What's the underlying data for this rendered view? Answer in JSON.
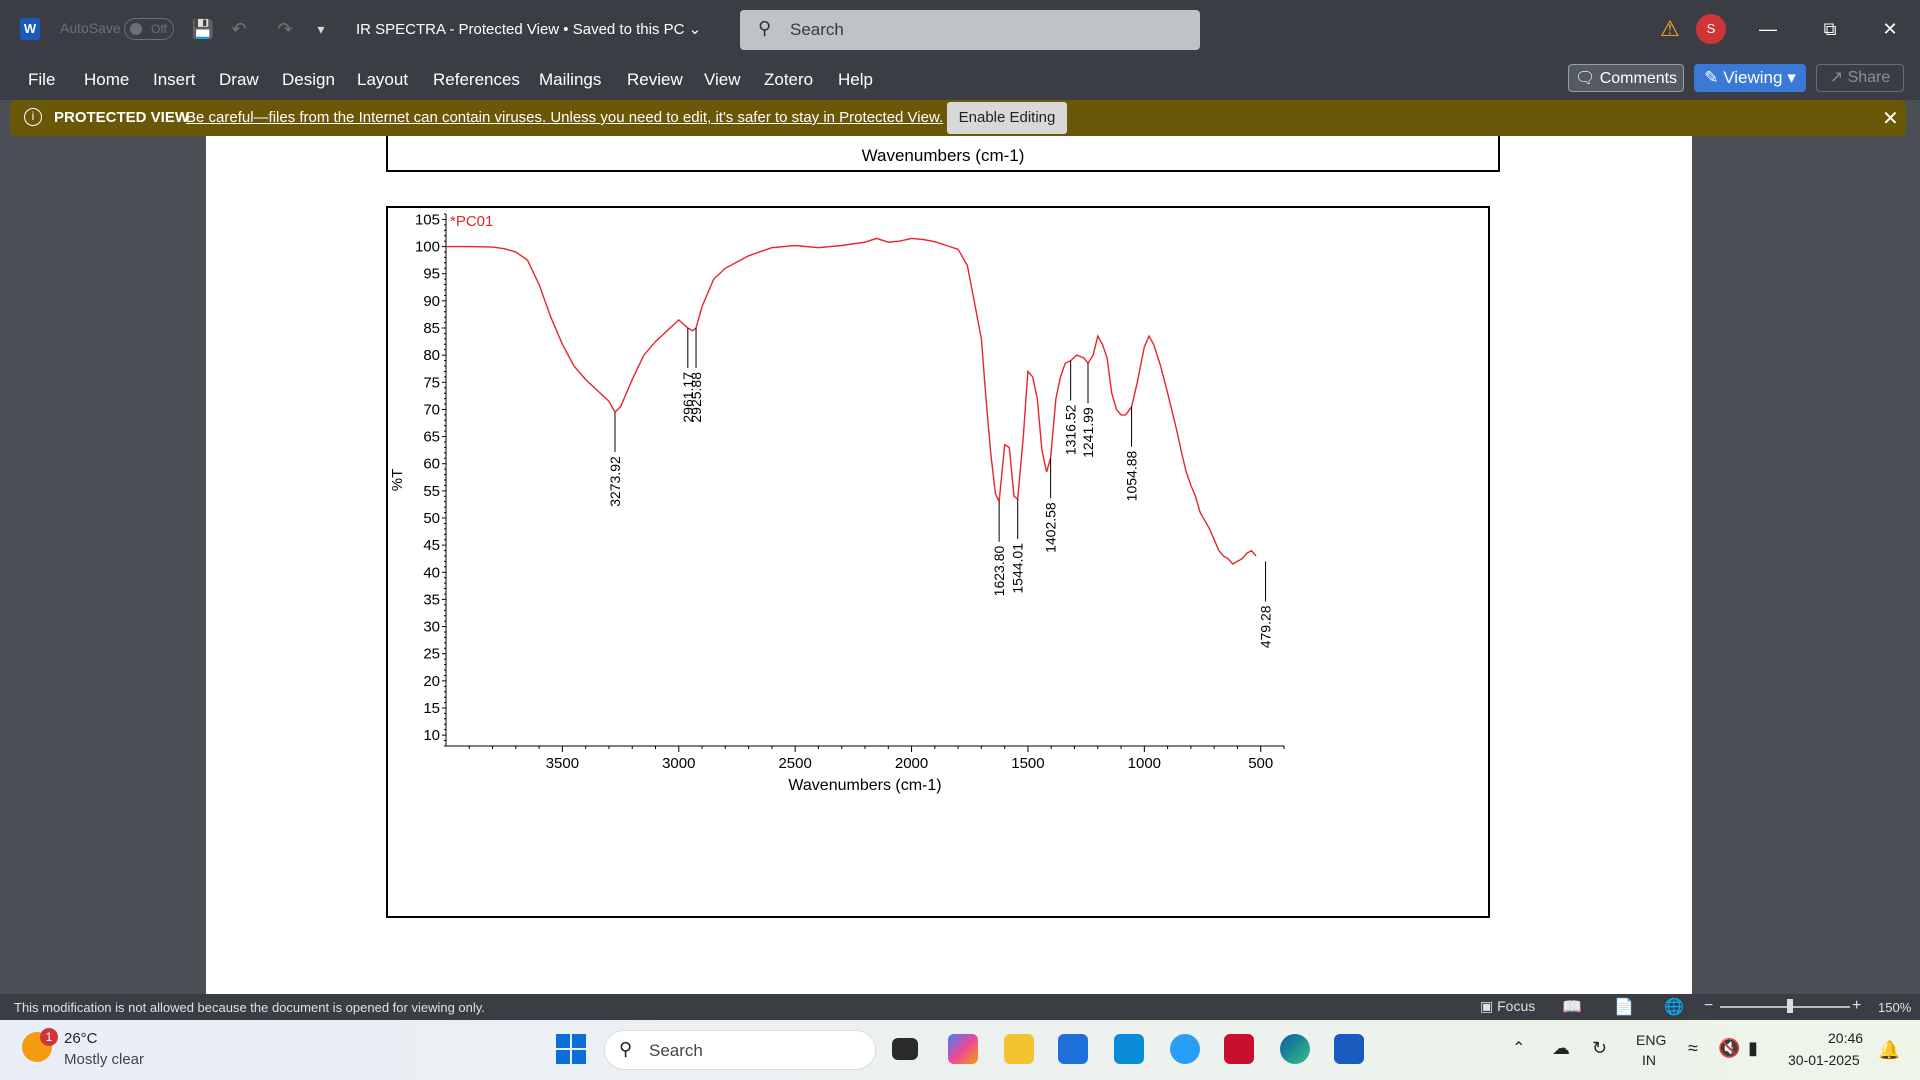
{
  "titlebar": {
    "app_letter": "W",
    "autosave_label": "AutoSave",
    "autosave_state": "Off",
    "doc_title": "IR SPECTRA  -  Protected View • Saved to this PC ⌄",
    "search_placeholder": "Search",
    "avatar_initial": "S"
  },
  "ribbon": {
    "tabs": [
      "File",
      "Home",
      "Insert",
      "Draw",
      "Design",
      "Layout",
      "References",
      "Mailings",
      "Review",
      "View",
      "Zotero",
      "Help"
    ],
    "comments_label": "Comments",
    "viewing_label": "Viewing",
    "share_label": "Share"
  },
  "protected_view": {
    "title": "PROTECTED VIEW",
    "message": "Be careful—files from the Internet can contain viruses. Unless you need to edit, it's safer to stay in Protected View.",
    "enable_label": "Enable Editing"
  },
  "document": {
    "prev_chart_xlabel": "Wavenumbers (cm-1)"
  },
  "chart_data": {
    "type": "line",
    "series": [
      {
        "name": "*PC01",
        "color": "#e8242c"
      }
    ],
    "xlabel": "Wavenumbers (cm-1)",
    "ylabel": "%T",
    "xlim": [
      4000,
      400
    ],
    "ylim": [
      8,
      106
    ],
    "x_ticks": [
      3500,
      3000,
      2500,
      2000,
      1500,
      1000,
      500
    ],
    "y_ticks": [
      105,
      100,
      95,
      90,
      85,
      80,
      75,
      70,
      65,
      60,
      55,
      50,
      45,
      40,
      35,
      30,
      25,
      20,
      15,
      10
    ],
    "x": [
      4000,
      3900,
      3800,
      3750,
      3700,
      3650,
      3600,
      3550,
      3500,
      3450,
      3400,
      3350,
      3300,
      3273.92,
      3250,
      3200,
      3150,
      3100,
      3050,
      3000,
      2961.17,
      2940,
      2925.88,
      2900,
      2850,
      2800,
      2700,
      2600,
      2500,
      2400,
      2300,
      2200,
      2150,
      2100,
      2050,
      2000,
      1950,
      1900,
      1850,
      1800,
      1760,
      1700,
      1680,
      1660,
      1640,
      1623.8,
      1600,
      1580,
      1560,
      1544.01,
      1520,
      1500,
      1480,
      1460,
      1440,
      1420,
      1402.58,
      1380,
      1360,
      1340,
      1316.52,
      1290,
      1260,
      1241.99,
      1220,
      1200,
      1180,
      1160,
      1140,
      1120,
      1100,
      1080,
      1054.88,
      1030,
      1000,
      980,
      960,
      930,
      900,
      880,
      860,
      840,
      820,
      800,
      780,
      760,
      740,
      720,
      700,
      680,
      660,
      640,
      620,
      600,
      580,
      560,
      540,
      520,
      500,
      479.28,
      460,
      440,
      420,
      400
    ],
    "y": [
      100,
      100,
      99.9,
      99.6,
      99,
      97.5,
      93,
      87,
      82,
      78,
      75.5,
      73.5,
      71.5,
      69.5,
      70.5,
      75.5,
      80,
      82.5,
      84.5,
      86.5,
      85,
      84.5,
      85,
      89,
      94,
      96,
      98.3,
      99.8,
      100.2,
      99.8,
      100.2,
      100.8,
      101.5,
      100.8,
      101,
      101.5,
      101.3,
      100.9,
      100.2,
      99.5,
      96.5,
      83,
      72,
      62,
      54.5,
      53,
      63.5,
      63,
      54,
      53.5,
      65,
      77,
      76,
      72,
      62.5,
      58.5,
      61,
      72,
      76,
      78.5,
      79,
      80,
      79.5,
      78.5,
      80,
      83.5,
      82,
      79.5,
      73,
      70,
      69,
      69,
      70.5,
      75,
      81.5,
      83.5,
      82,
      78,
      73,
      69.5,
      66,
      62,
      58.5,
      56,
      54,
      51,
      49.5,
      48,
      46,
      44,
      43,
      42.5,
      41.5,
      42,
      42.5,
      43.5,
      44,
      43
    ],
    "peaks": [
      {
        "label": "3273.92",
        "x": 3273.92,
        "y": 69.5
      },
      {
        "label": "2961.17",
        "x": 2961.17,
        "y": 85
      },
      {
        "label": "2925.88",
        "x": 2925.88,
        "y": 85
      },
      {
        "label": "1623.80",
        "x": 1623.8,
        "y": 53
      },
      {
        "label": "1544.01",
        "x": 1544.01,
        "y": 53.5
      },
      {
        "label": "1402.58",
        "x": 1402.58,
        "y": 61
      },
      {
        "label": "1316.52",
        "x": 1316.52,
        "y": 79
      },
      {
        "label": "1241.99",
        "x": 1241.99,
        "y": 78.5
      },
      {
        "label": "1054.88",
        "x": 1054.88,
        "y": 70.5
      },
      {
        "label": "479.28",
        "x": 479.28,
        "y": 42
      }
    ]
  },
  "statusbar": {
    "message": "This modification is not allowed because the document is opened for viewing only.",
    "focus_label": "Focus",
    "zoom_level": "150%"
  },
  "taskbar": {
    "weather_badge": "1",
    "temperature": "26°C",
    "condition": "Mostly clear",
    "search_placeholder": "Search",
    "lang_line1": "ENG",
    "lang_line2": "IN",
    "time": "20:46",
    "date": "30-01-2025"
  }
}
